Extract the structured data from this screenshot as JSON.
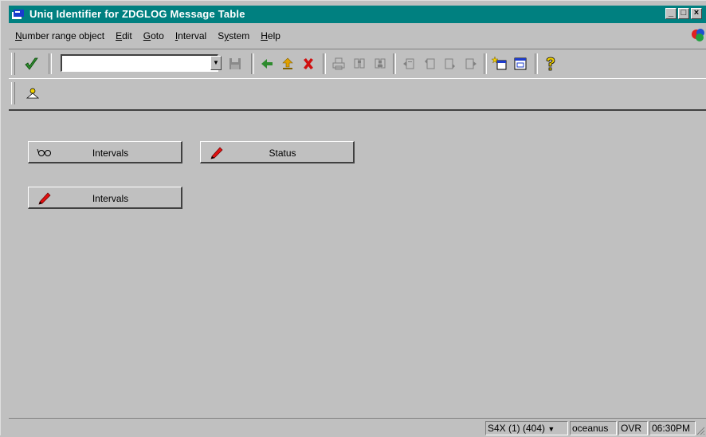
{
  "window": {
    "title": "Uniq Identifier for ZDGLOG Message Table",
    "controls": {
      "minimize": "_",
      "maximize": "□",
      "close": "×"
    }
  },
  "menu": [
    {
      "label": "Number range object",
      "key": "N"
    },
    {
      "label": "Edit",
      "key": "E"
    },
    {
      "label": "Goto",
      "key": "G"
    },
    {
      "label": "Interval",
      "key": "I"
    },
    {
      "label": "System",
      "key": "y"
    },
    {
      "label": "Help",
      "key": "H"
    }
  ],
  "toolbar": {
    "command_field_value": "",
    "icons": [
      "enter-check-icon",
      "save-icon",
      "back-icon",
      "exit-icon",
      "cancel-icon",
      "print-icon",
      "find-icon",
      "find-next-icon",
      "first-page-icon",
      "previous-page-icon",
      "next-page-icon",
      "last-page-icon",
      "create-session-icon",
      "shortcut-icon",
      "help-icon"
    ]
  },
  "app_toolbar": {
    "icons": [
      "display-object-icon"
    ]
  },
  "buttons": {
    "intervals_display": "Intervals",
    "status_change": "Status",
    "intervals_change": "Intervals"
  },
  "status_bar": {
    "system": "S4X (1) (404)",
    "server": "oceanus",
    "mode": "OVR",
    "time": "06:30PM"
  },
  "colors": {
    "titlebar": "#008080",
    "face": "#c0c0c0",
    "check_green": "#2e8b2e",
    "pencil_red": "#e01010"
  }
}
